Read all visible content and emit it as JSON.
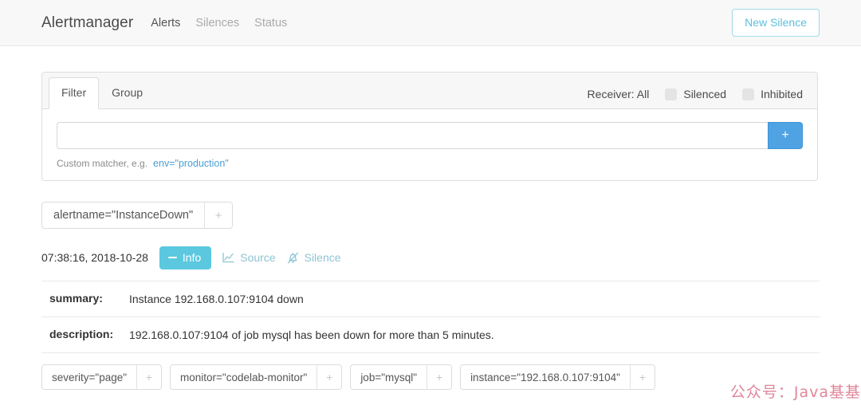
{
  "navbar": {
    "brand": "Alertmanager",
    "links": [
      {
        "label": "Alerts",
        "active": true
      },
      {
        "label": "Silences",
        "active": false
      },
      {
        "label": "Status",
        "active": false
      }
    ],
    "new_silence_label": "New Silence",
    "accent_color": "#5bc0de"
  },
  "filter_card": {
    "tabs": [
      {
        "label": "Filter",
        "active": true
      },
      {
        "label": "Group",
        "active": false
      }
    ],
    "receiver_label": "Receiver: All",
    "checkboxes": [
      {
        "label": "Silenced",
        "checked": false
      },
      {
        "label": "Inhibited",
        "checked": false
      }
    ],
    "matcher_input_value": "",
    "matcher_input_placeholder": "",
    "add_button_label": "+",
    "help_prefix": "Custom matcher, e.g.",
    "help_example": "env=\"production\"",
    "add_button_color": "#4fa3e3"
  },
  "group": {
    "group_labels": [
      {
        "text": "alertname=\"InstanceDown\"",
        "add_label": "+"
      }
    ],
    "alert": {
      "timestamp": "07:38:16, 2018-10-28",
      "info_button_label": "Info",
      "source_label": "Source",
      "silence_label": "Silence",
      "info_color": "#5bc8e0",
      "annotations": [
        {
          "key": "summary:",
          "value": "Instance 192.168.0.107:9104 down"
        },
        {
          "key": "description:",
          "value": "192.168.0.107:9104 of job mysql has been down for more than 5 minutes."
        }
      ],
      "labels": [
        {
          "text": "severity=\"page\"",
          "add_label": "+"
        },
        {
          "text": "monitor=\"codelab-monitor\"",
          "add_label": "+"
        },
        {
          "text": "job=\"mysql\"",
          "add_label": "+"
        },
        {
          "text": "instance=\"192.168.0.107:9104\"",
          "add_label": "+"
        }
      ]
    }
  },
  "watermark": {
    "text": "公众号：Java基基",
    "color": "#e0879a"
  }
}
